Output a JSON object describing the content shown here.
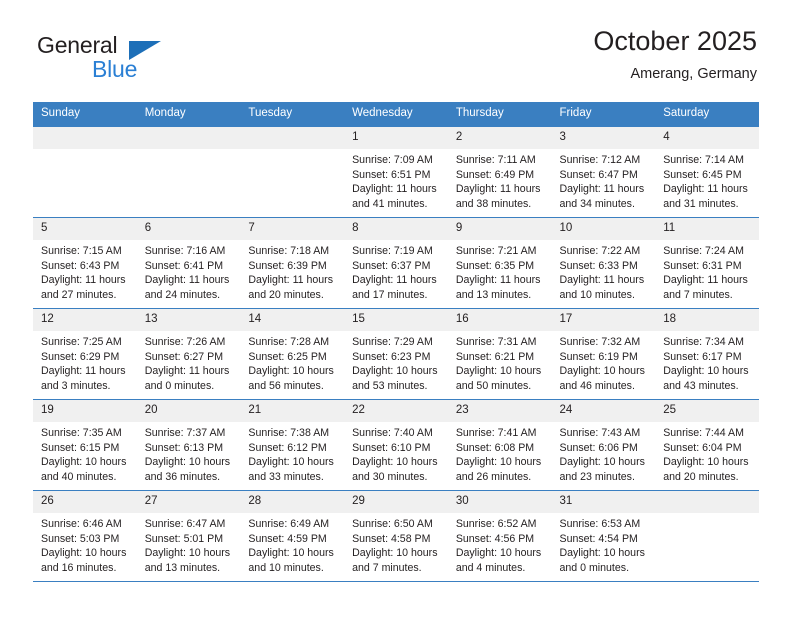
{
  "brand": {
    "name_top": "General",
    "name_bottom": "Blue",
    "accent_color": "#2a7fd4",
    "triangle_color": "#1d6fb8"
  },
  "header": {
    "title": "October 2025",
    "subtitle": "Amerang, Germany",
    "header_bg": "#3a7fc1",
    "daynum_bg": "#f0f0f0"
  },
  "weekdays": [
    "Sunday",
    "Monday",
    "Tuesday",
    "Wednesday",
    "Thursday",
    "Friday",
    "Saturday"
  ],
  "labels": {
    "sunrise": "Sunrise:",
    "sunset": "Sunset:",
    "daylight": "Daylight:"
  },
  "weeks": [
    [
      {
        "day": "",
        "empty": true
      },
      {
        "day": "",
        "empty": true
      },
      {
        "day": "",
        "empty": true
      },
      {
        "day": "1",
        "sunrise": "Sunrise: 7:09 AM",
        "sunset": "Sunset: 6:51 PM",
        "daylight_1": "Daylight: 11 hours",
        "daylight_2": "and 41 minutes."
      },
      {
        "day": "2",
        "sunrise": "Sunrise: 7:11 AM",
        "sunset": "Sunset: 6:49 PM",
        "daylight_1": "Daylight: 11 hours",
        "daylight_2": "and 38 minutes."
      },
      {
        "day": "3",
        "sunrise": "Sunrise: 7:12 AM",
        "sunset": "Sunset: 6:47 PM",
        "daylight_1": "Daylight: 11 hours",
        "daylight_2": "and 34 minutes."
      },
      {
        "day": "4",
        "sunrise": "Sunrise: 7:14 AM",
        "sunset": "Sunset: 6:45 PM",
        "daylight_1": "Daylight: 11 hours",
        "daylight_2": "and 31 minutes."
      }
    ],
    [
      {
        "day": "5",
        "sunrise": "Sunrise: 7:15 AM",
        "sunset": "Sunset: 6:43 PM",
        "daylight_1": "Daylight: 11 hours",
        "daylight_2": "and 27 minutes."
      },
      {
        "day": "6",
        "sunrise": "Sunrise: 7:16 AM",
        "sunset": "Sunset: 6:41 PM",
        "daylight_1": "Daylight: 11 hours",
        "daylight_2": "and 24 minutes."
      },
      {
        "day": "7",
        "sunrise": "Sunrise: 7:18 AM",
        "sunset": "Sunset: 6:39 PM",
        "daylight_1": "Daylight: 11 hours",
        "daylight_2": "and 20 minutes."
      },
      {
        "day": "8",
        "sunrise": "Sunrise: 7:19 AM",
        "sunset": "Sunset: 6:37 PM",
        "daylight_1": "Daylight: 11 hours",
        "daylight_2": "and 17 minutes."
      },
      {
        "day": "9",
        "sunrise": "Sunrise: 7:21 AM",
        "sunset": "Sunset: 6:35 PM",
        "daylight_1": "Daylight: 11 hours",
        "daylight_2": "and 13 minutes."
      },
      {
        "day": "10",
        "sunrise": "Sunrise: 7:22 AM",
        "sunset": "Sunset: 6:33 PM",
        "daylight_1": "Daylight: 11 hours",
        "daylight_2": "and 10 minutes."
      },
      {
        "day": "11",
        "sunrise": "Sunrise: 7:24 AM",
        "sunset": "Sunset: 6:31 PM",
        "daylight_1": "Daylight: 11 hours",
        "daylight_2": "and 7 minutes."
      }
    ],
    [
      {
        "day": "12",
        "sunrise": "Sunrise: 7:25 AM",
        "sunset": "Sunset: 6:29 PM",
        "daylight_1": "Daylight: 11 hours",
        "daylight_2": "and 3 minutes."
      },
      {
        "day": "13",
        "sunrise": "Sunrise: 7:26 AM",
        "sunset": "Sunset: 6:27 PM",
        "daylight_1": "Daylight: 11 hours",
        "daylight_2": "and 0 minutes."
      },
      {
        "day": "14",
        "sunrise": "Sunrise: 7:28 AM",
        "sunset": "Sunset: 6:25 PM",
        "daylight_1": "Daylight: 10 hours",
        "daylight_2": "and 56 minutes."
      },
      {
        "day": "15",
        "sunrise": "Sunrise: 7:29 AM",
        "sunset": "Sunset: 6:23 PM",
        "daylight_1": "Daylight: 10 hours",
        "daylight_2": "and 53 minutes."
      },
      {
        "day": "16",
        "sunrise": "Sunrise: 7:31 AM",
        "sunset": "Sunset: 6:21 PM",
        "daylight_1": "Daylight: 10 hours",
        "daylight_2": "and 50 minutes."
      },
      {
        "day": "17",
        "sunrise": "Sunrise: 7:32 AM",
        "sunset": "Sunset: 6:19 PM",
        "daylight_1": "Daylight: 10 hours",
        "daylight_2": "and 46 minutes."
      },
      {
        "day": "18",
        "sunrise": "Sunrise: 7:34 AM",
        "sunset": "Sunset: 6:17 PM",
        "daylight_1": "Daylight: 10 hours",
        "daylight_2": "and 43 minutes."
      }
    ],
    [
      {
        "day": "19",
        "sunrise": "Sunrise: 7:35 AM",
        "sunset": "Sunset: 6:15 PM",
        "daylight_1": "Daylight: 10 hours",
        "daylight_2": "and 40 minutes."
      },
      {
        "day": "20",
        "sunrise": "Sunrise: 7:37 AM",
        "sunset": "Sunset: 6:13 PM",
        "daylight_1": "Daylight: 10 hours",
        "daylight_2": "and 36 minutes."
      },
      {
        "day": "21",
        "sunrise": "Sunrise: 7:38 AM",
        "sunset": "Sunset: 6:12 PM",
        "daylight_1": "Daylight: 10 hours",
        "daylight_2": "and 33 minutes."
      },
      {
        "day": "22",
        "sunrise": "Sunrise: 7:40 AM",
        "sunset": "Sunset: 6:10 PM",
        "daylight_1": "Daylight: 10 hours",
        "daylight_2": "and 30 minutes."
      },
      {
        "day": "23",
        "sunrise": "Sunrise: 7:41 AM",
        "sunset": "Sunset: 6:08 PM",
        "daylight_1": "Daylight: 10 hours",
        "daylight_2": "and 26 minutes."
      },
      {
        "day": "24",
        "sunrise": "Sunrise: 7:43 AM",
        "sunset": "Sunset: 6:06 PM",
        "daylight_1": "Daylight: 10 hours",
        "daylight_2": "and 23 minutes."
      },
      {
        "day": "25",
        "sunrise": "Sunrise: 7:44 AM",
        "sunset": "Sunset: 6:04 PM",
        "daylight_1": "Daylight: 10 hours",
        "daylight_2": "and 20 minutes."
      }
    ],
    [
      {
        "day": "26",
        "sunrise": "Sunrise: 6:46 AM",
        "sunset": "Sunset: 5:03 PM",
        "daylight_1": "Daylight: 10 hours",
        "daylight_2": "and 16 minutes."
      },
      {
        "day": "27",
        "sunrise": "Sunrise: 6:47 AM",
        "sunset": "Sunset: 5:01 PM",
        "daylight_1": "Daylight: 10 hours",
        "daylight_2": "and 13 minutes."
      },
      {
        "day": "28",
        "sunrise": "Sunrise: 6:49 AM",
        "sunset": "Sunset: 4:59 PM",
        "daylight_1": "Daylight: 10 hours",
        "daylight_2": "and 10 minutes."
      },
      {
        "day": "29",
        "sunrise": "Sunrise: 6:50 AM",
        "sunset": "Sunset: 4:58 PM",
        "daylight_1": "Daylight: 10 hours",
        "daylight_2": "and 7 minutes."
      },
      {
        "day": "30",
        "sunrise": "Sunrise: 6:52 AM",
        "sunset": "Sunset: 4:56 PM",
        "daylight_1": "Daylight: 10 hours",
        "daylight_2": "and 4 minutes."
      },
      {
        "day": "31",
        "sunrise": "Sunrise: 6:53 AM",
        "sunset": "Sunset: 4:54 PM",
        "daylight_1": "Daylight: 10 hours",
        "daylight_2": "and 0 minutes."
      },
      {
        "day": "",
        "empty": true
      }
    ]
  ]
}
